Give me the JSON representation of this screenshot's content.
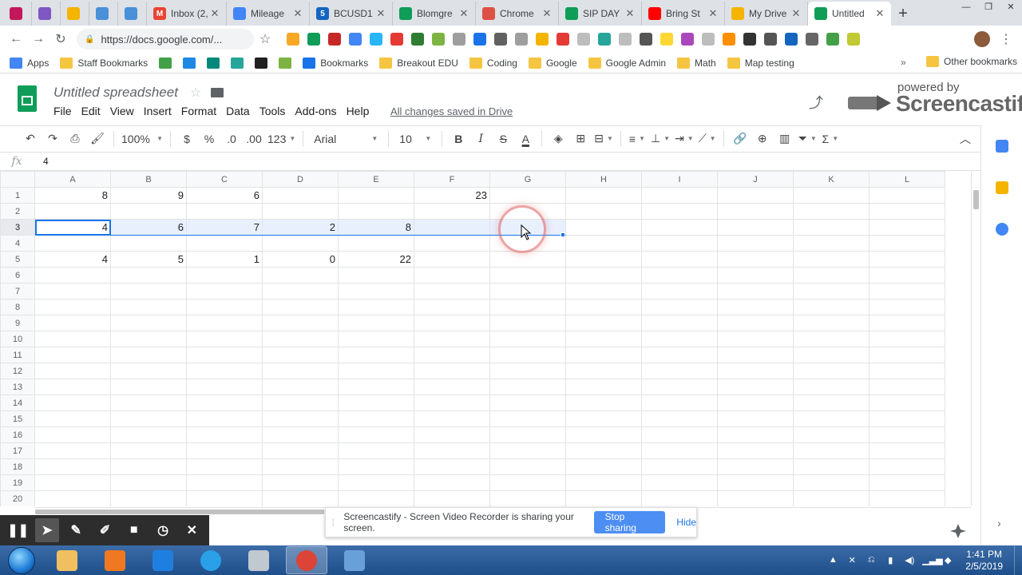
{
  "browser": {
    "tabs": [
      {
        "title": "",
        "color": "#c2185b",
        "letter": ""
      },
      {
        "title": "",
        "color": "#7e57c2",
        "letter": ""
      },
      {
        "title": "",
        "color": "#f4b400",
        "letter": ""
      },
      {
        "title": "",
        "color": "#4a90d9",
        "letter": ""
      },
      {
        "title": "",
        "color": "#4a90d9",
        "letter": ""
      },
      {
        "title": "Inbox (2,",
        "color": "#ea4335",
        "letter": "M"
      },
      {
        "title": "Mileage",
        "color": "#4285f4",
        "letter": ""
      },
      {
        "title": "BCUSD1",
        "color": "#1565c0",
        "letter": "5"
      },
      {
        "title": "Blomgre",
        "color": "#0f9d58",
        "letter": ""
      },
      {
        "title": "Chrome",
        "color": "#dd5144",
        "letter": ""
      },
      {
        "title": "SIP DAY",
        "color": "#0f9d58",
        "letter": ""
      },
      {
        "title": "Bring St",
        "color": "#ff0000",
        "letter": ""
      },
      {
        "title": "My Drive",
        "color": "#f4b400",
        "letter": ""
      },
      {
        "title": "Untitled",
        "color": "#0f9d58",
        "letter": ""
      }
    ],
    "url": "https://docs.google.com/..."
  },
  "bookmarks": {
    "items": [
      {
        "label": "Apps",
        "color": "#4285f4"
      },
      {
        "label": "Staff Bookmarks",
        "color": "#f5c542"
      },
      {
        "label": "",
        "color": "#43a047"
      },
      {
        "label": "",
        "color": "#1e88e5"
      },
      {
        "label": "",
        "color": "#00897b"
      },
      {
        "label": "",
        "color": "#26a69a"
      },
      {
        "label": "",
        "color": "#212121"
      },
      {
        "label": "",
        "color": "#7cb342"
      },
      {
        "label": "Bookmarks",
        "color": "#1a73e8"
      },
      {
        "label": "Breakout EDU",
        "color": "#f5c542"
      },
      {
        "label": "Coding",
        "color": "#f5c542"
      },
      {
        "label": "Google",
        "color": "#f5c542"
      },
      {
        "label": "Google Admin",
        "color": "#f5c542"
      },
      {
        "label": "Math",
        "color": "#f5c542"
      },
      {
        "label": "Map testing",
        "color": "#f5c542"
      }
    ],
    "more": "»",
    "other": "Other bookmarks"
  },
  "sheet": {
    "title": "Untitled spreadsheet",
    "menu": [
      "File",
      "Edit",
      "View",
      "Insert",
      "Format",
      "Data",
      "Tools",
      "Add-ons",
      "Help"
    ],
    "saved_status": "All changes saved in Drive",
    "watermark_powered": "powered by",
    "watermark_brand": "Screencastify",
    "toolbar": {
      "zoom": "100%",
      "currency": "$",
      "percent": "%",
      "dec_less": ".0",
      "dec_more": ".00",
      "format": "123",
      "font": "Arial",
      "font_size": "10"
    },
    "formula_label": "fx",
    "formula_value": "4",
    "columns": [
      "A",
      "B",
      "C",
      "D",
      "E",
      "F",
      "G",
      "H",
      "I",
      "J",
      "K",
      "L"
    ],
    "row_numbers": [
      "1",
      "2",
      "3",
      "4",
      "5",
      "6",
      "7",
      "8",
      "9",
      "10",
      "11",
      "12",
      "13",
      "14",
      "15",
      "16",
      "17",
      "18",
      "19",
      "20"
    ],
    "rows": [
      [
        "8",
        "9",
        "6",
        "",
        "",
        "23",
        "",
        "",
        "",
        "",
        "",
        ""
      ],
      [
        "",
        "",
        "",
        "",
        "",
        "",
        "",
        "",
        "",
        "",
        "",
        ""
      ],
      [
        "4",
        "6",
        "7",
        "2",
        "8",
        "",
        "",
        "",
        "",
        "",
        "",
        ""
      ],
      [
        "",
        "",
        "",
        "",
        "",
        "",
        "",
        "",
        "",
        "",
        "",
        ""
      ],
      [
        "4",
        "5",
        "1",
        "0",
        "22",
        "",
        "",
        "",
        "",
        "",
        "",
        ""
      ],
      [
        "",
        "",
        "",
        "",
        "",
        "",
        "",
        "",
        "",
        "",
        "",
        ""
      ],
      [
        "",
        "",
        "",
        "",
        "",
        "",
        "",
        "",
        "",
        "",
        "",
        ""
      ],
      [
        "",
        "",
        "",
        "",
        "",
        "",
        "",
        "",
        "",
        "",
        "",
        ""
      ],
      [
        "",
        "",
        "",
        "",
        "",
        "",
        "",
        "",
        "",
        "",
        "",
        ""
      ],
      [
        "",
        "",
        "",
        "",
        "",
        "",
        "",
        "",
        "",
        "",
        "",
        ""
      ],
      [
        "",
        "",
        "",
        "",
        "",
        "",
        "",
        "",
        "",
        "",
        "",
        ""
      ],
      [
        "",
        "",
        "",
        "",
        "",
        "",
        "",
        "",
        "",
        "",
        "",
        ""
      ],
      [
        "",
        "",
        "",
        "",
        "",
        "",
        "",
        "",
        "",
        "",
        "",
        ""
      ],
      [
        "",
        "",
        "",
        "",
        "",
        "",
        "",
        "",
        "",
        "",
        "",
        ""
      ],
      [
        "",
        "",
        "",
        "",
        "",
        "",
        "",
        "",
        "",
        "",
        "",
        ""
      ],
      [
        "",
        "",
        "",
        "",
        "",
        "",
        "",
        "",
        "",
        "",
        "",
        ""
      ],
      [
        "",
        "",
        "",
        "",
        "",
        "",
        "",
        "",
        "",
        "",
        "",
        ""
      ],
      [
        "",
        "",
        "",
        "",
        "",
        "",
        "",
        "",
        "",
        "",
        "",
        ""
      ],
      [
        "",
        "",
        "",
        "",
        "",
        "",
        "",
        "",
        "",
        "",
        "",
        ""
      ],
      [
        "",
        "",
        "",
        "",
        "",
        "",
        "",
        "",
        "",
        "",
        "",
        ""
      ]
    ],
    "selected_row": 3,
    "selected_cols": [
      "A",
      "G"
    ],
    "active_cell": "A3"
  },
  "screencastify": {
    "notice_text": "Screencastify - Screen Video Recorder is sharing your screen.",
    "stop_label": "Stop sharing",
    "hide_label": "Hide",
    "controls": [
      "pause-icon",
      "pointer-icon",
      "pen-icon",
      "highlighter-icon",
      "camera-icon",
      "timer-icon",
      "close-icon"
    ]
  },
  "taskbar": {
    "apps": [
      {
        "name": "file-explorer-icon",
        "color": "#f0c060"
      },
      {
        "name": "media-player-icon",
        "color": "#f07820"
      },
      {
        "name": "dropbox-icon",
        "color": "#1f7fe0"
      },
      {
        "name": "ie-icon",
        "color": "#2aa0e8"
      },
      {
        "name": "snipping-tool-icon",
        "color": "#c0c8d0"
      },
      {
        "name": "chrome-icon",
        "color": "#db4437"
      },
      {
        "name": "control-panel-icon",
        "color": "#6aa0d8"
      }
    ],
    "time": "1:41 PM",
    "date": "2/5/2019"
  }
}
